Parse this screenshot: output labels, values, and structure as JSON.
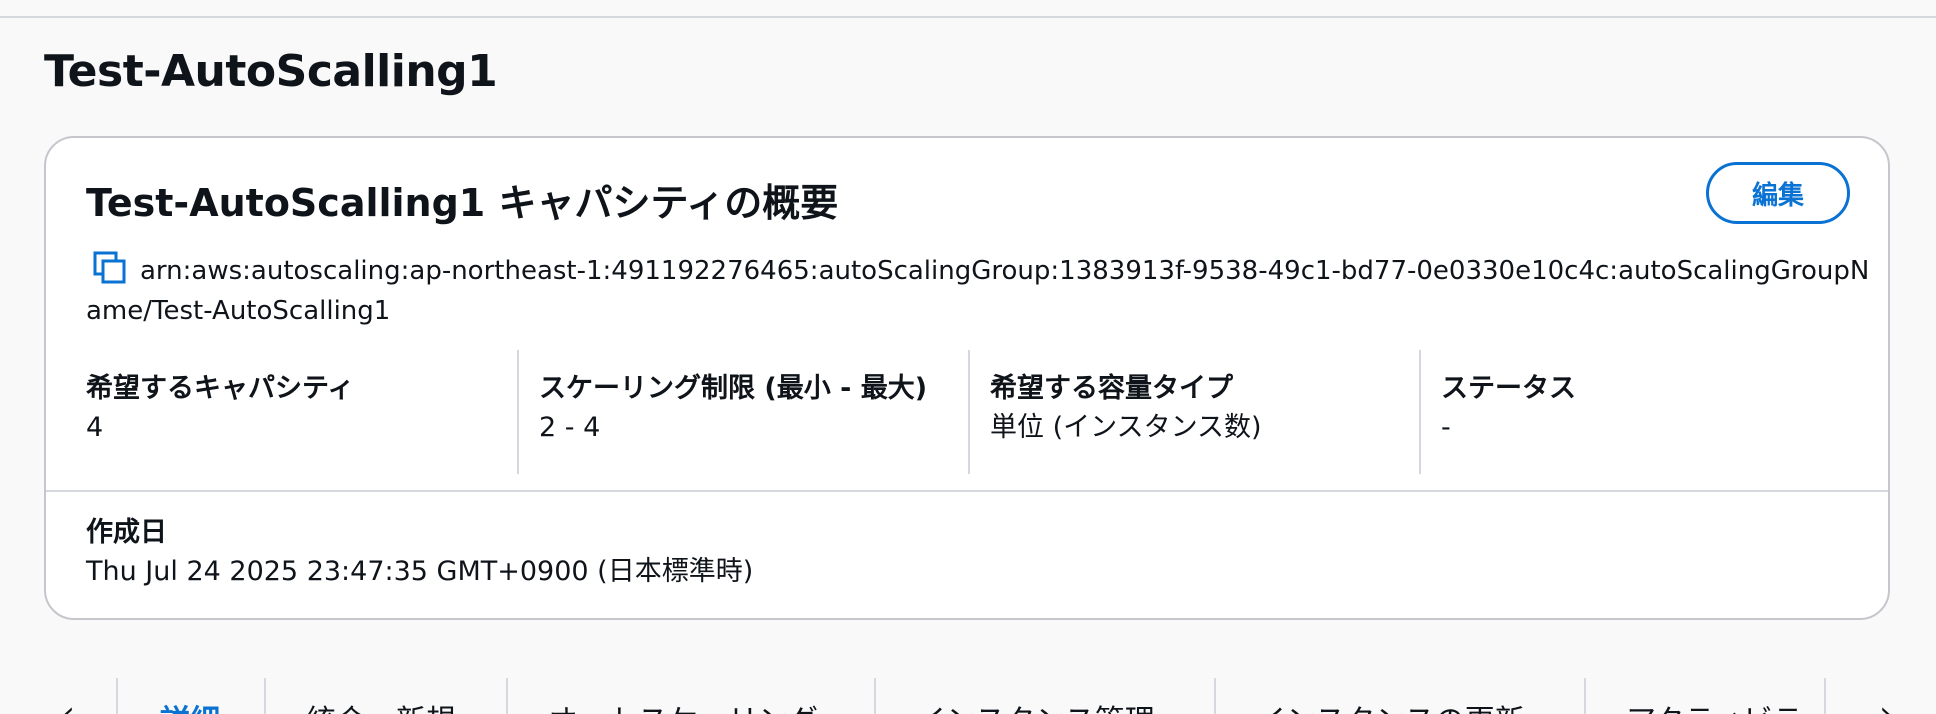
{
  "page": {
    "title": "Test-AutoScalling1"
  },
  "card": {
    "title": "Test-AutoScalling1 キャパシティの概要",
    "edit_label": "編集",
    "arn": "arn:aws:autoscaling:ap-northeast-1:491192276465:autoScalingGroup:1383913f-9538-49c1-bd77-0e0330e10c4c:autoScalingGroupName/Test-AutoScalling1",
    "fields": [
      {
        "label": "希望するキャパシティ",
        "value": "4"
      },
      {
        "label": "スケーリング制限 (最小 - 最大)",
        "value": "2 - 4"
      },
      {
        "label": "希望する容量タイプ",
        "value": "単位 (インスタンス数)"
      },
      {
        "label": "ステータス",
        "value": "-"
      }
    ],
    "created": {
      "label": "作成日",
      "value": "Thu Jul 24 2025 23:47:35 GMT+0900 (日本標準時)"
    }
  },
  "tabs": [
    {
      "label": "詳細",
      "active": true
    },
    {
      "label": "統合 - 新規"
    },
    {
      "label": "オートスケーリング"
    },
    {
      "label": "インスタンス管理"
    },
    {
      "label": "インスタンスの更新"
    },
    {
      "label": "アクティビティ"
    }
  ],
  "icons": {
    "copy": "copy-icon",
    "prev": "chevron-left-icon",
    "next": "chevron-right-icon"
  },
  "colors": {
    "accent": "#0972d3",
    "text": "#0f141a",
    "border": "#c6c6cd"
  }
}
